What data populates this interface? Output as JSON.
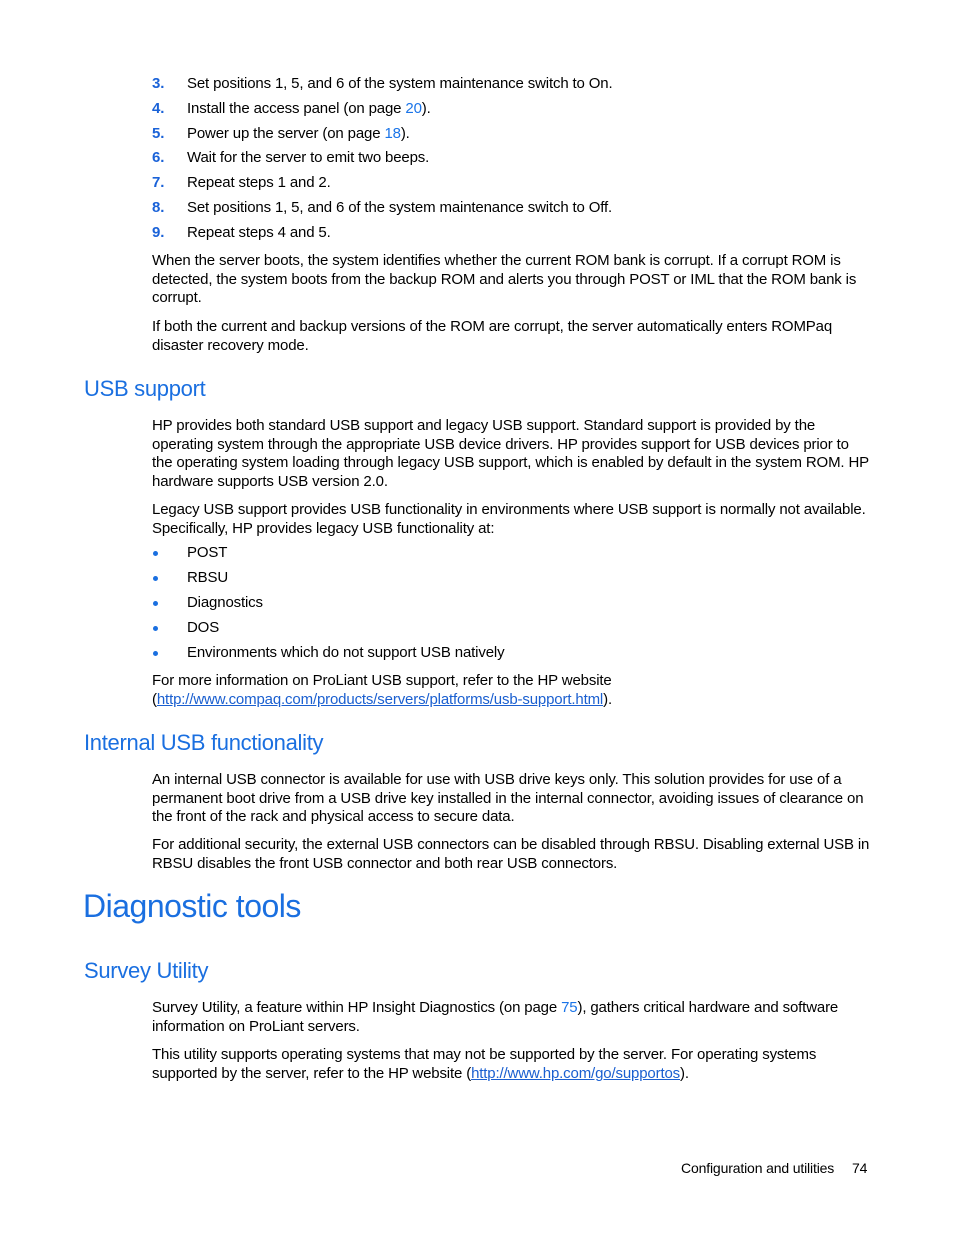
{
  "steps": [
    {
      "num": "3.",
      "text": "Set positions 1, 5, and 6 of the system maintenance switch to On."
    },
    {
      "num": "4.",
      "text_before": "Install the access panel (on page ",
      "link": "20",
      "text_after": ")."
    },
    {
      "num": "5.",
      "text_before": "Power up the server (on page ",
      "link": "18",
      "text_after": ")."
    },
    {
      "num": "6.",
      "text": "Wait for the server to emit two beeps."
    },
    {
      "num": "7.",
      "text": "Repeat steps 1 and 2."
    },
    {
      "num": "8.",
      "text": "Set positions 1, 5, and 6 of the system maintenance switch to Off."
    },
    {
      "num": "9.",
      "text": "Repeat steps 4 and 5."
    }
  ],
  "rom_paragraphs": [
    "When the server boots, the system identifies whether the current ROM bank is corrupt. If a corrupt ROM is detected, the system boots from the backup ROM and alerts you through POST or IML that the ROM bank is corrupt.",
    "If both the current and backup versions of the ROM are corrupt, the server automatically enters ROMPaq disaster recovery mode."
  ],
  "usb_support": {
    "heading": "USB support",
    "paragraphs": [
      "HP provides both standard USB support and legacy USB support. Standard support is provided by the operating system through the appropriate USB device drivers. HP provides support for USB devices prior to the operating system loading through legacy USB support, which is enabled by default in the system ROM. HP hardware supports USB version 2.0.",
      "Legacy USB support provides USB functionality in environments where USB support is normally not available. Specifically, HP provides legacy USB functionality at:"
    ],
    "bullets": [
      "POST",
      "RBSU",
      "Diagnostics",
      "DOS",
      "Environments which do not support USB natively"
    ],
    "more_info_text": "For more information on ProLiant USB support, refer to the HP website",
    "more_info_prefix": "(",
    "more_info_url": "http://www.compaq.com/products/servers/platforms/usb-support.html",
    "more_info_suffix": ")."
  },
  "internal_usb": {
    "heading": "Internal USB functionality",
    "paragraphs": [
      "An internal USB connector is available for use with USB drive keys only. This solution provides for use of a permanent boot drive from a USB drive key installed in the internal connector, avoiding issues of clearance on the front of the rack and physical access to secure data.",
      "For additional security, the external USB connectors can be disabled through RBSU. Disabling external USB in RBSU disables the front USB connector and both rear USB connectors."
    ]
  },
  "diagnostic_tools": {
    "heading": "Diagnostic tools"
  },
  "survey_utility": {
    "heading": "Survey Utility",
    "p1_before": "Survey Utility, a feature within HP Insight Diagnostics (on page ",
    "p1_link": "75",
    "p1_after": "), gathers critical hardware and software information on ProLiant servers.",
    "p2_before": "This utility supports operating systems that may not be supported by the server. For operating systems supported by the server, refer to the HP website (",
    "p2_url": "http://www.hp.com/go/supportos",
    "p2_after": ")."
  },
  "footer": {
    "section": "Configuration and utilities",
    "page_number": "74"
  }
}
